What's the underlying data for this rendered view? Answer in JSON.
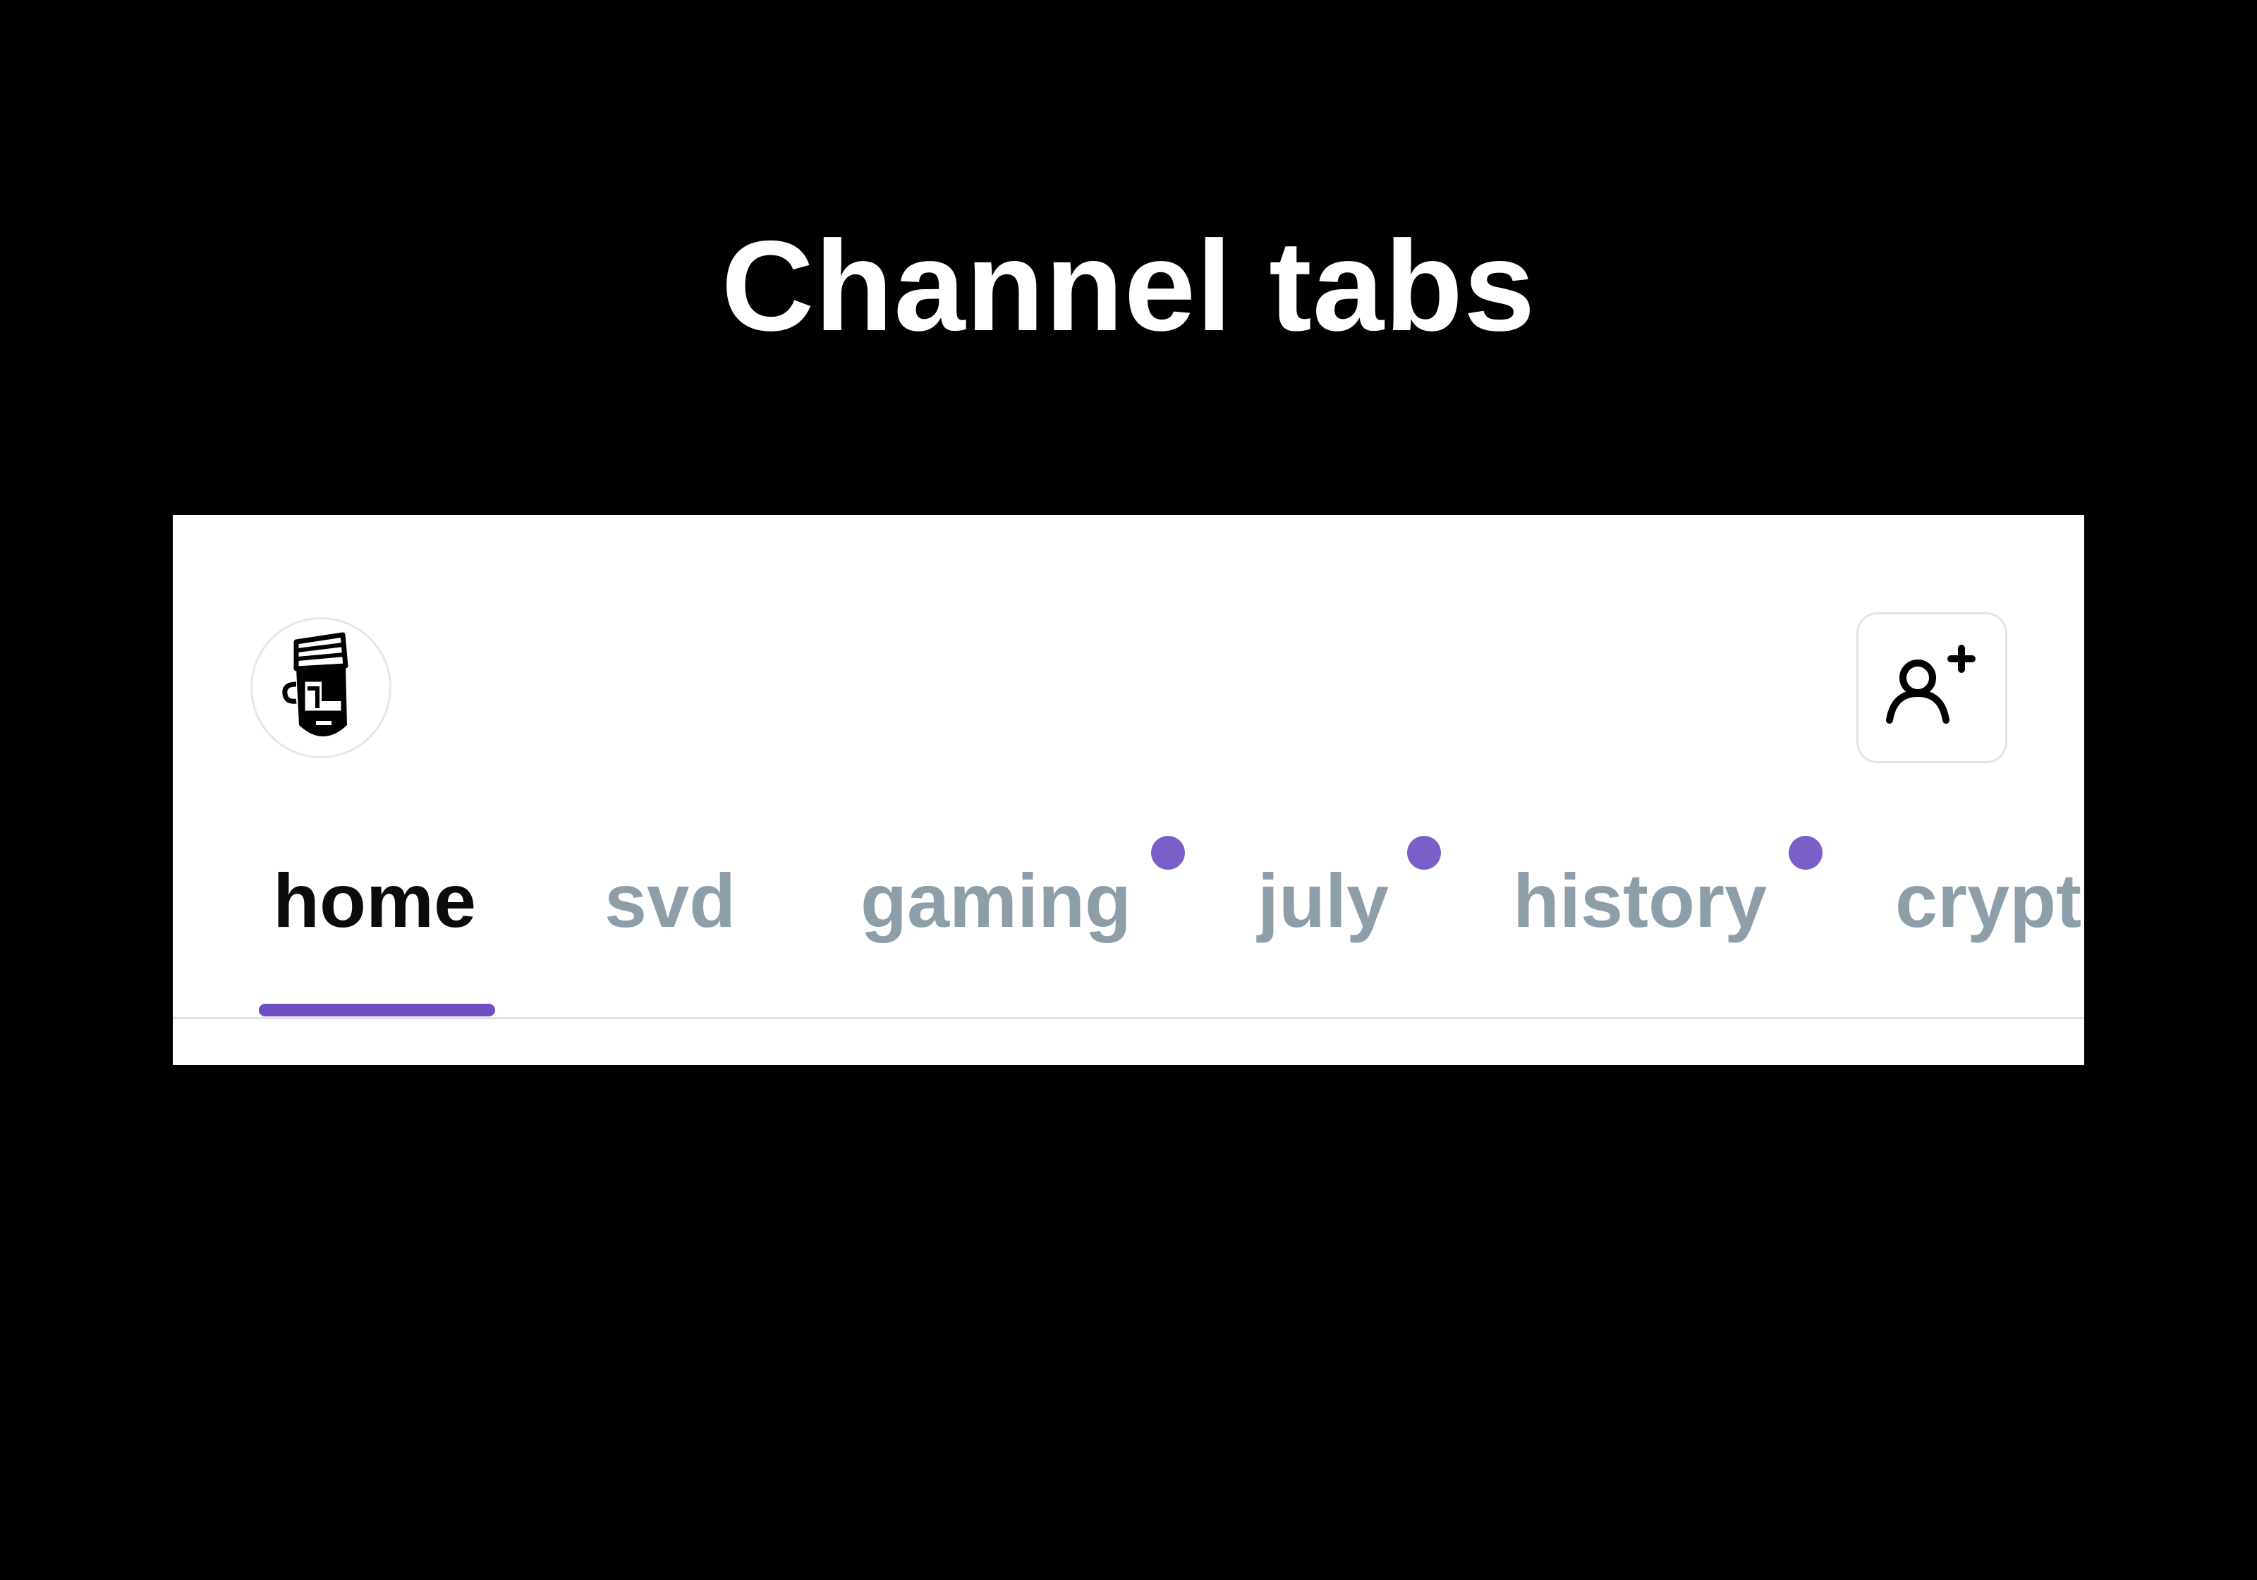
{
  "page": {
    "title": "Channel tabs"
  },
  "header": {
    "avatar_icon": "pirate-avatar-icon",
    "add_member_icon": "user-plus-icon"
  },
  "tabs": [
    {
      "label": "home",
      "active": true,
      "unread": false
    },
    {
      "label": "svd",
      "active": false,
      "unread": false
    },
    {
      "label": "gaming",
      "active": false,
      "unread": true
    },
    {
      "label": "july",
      "active": false,
      "unread": true
    },
    {
      "label": "history",
      "active": false,
      "unread": true
    },
    {
      "label": "crypt",
      "active": false,
      "unread": false
    }
  ],
  "colors": {
    "accent": "#6f4ec2",
    "unread_dot": "#7b5fc9",
    "active_tab_text": "#0b0b0b",
    "inactive_tab_text": "#8e9ea9"
  }
}
